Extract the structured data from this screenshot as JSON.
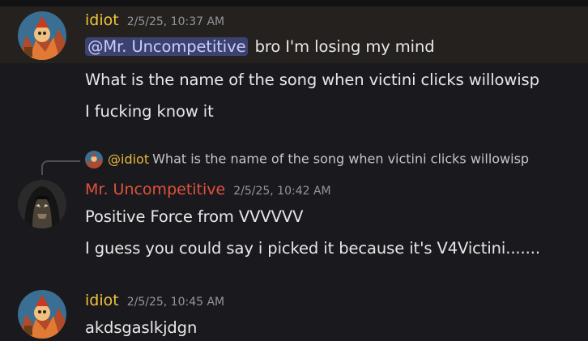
{
  "messages": [
    {
      "author": "idiot",
      "author_color": "#f0c23c",
      "timestamp": "2/5/25, 10:37 AM",
      "mention": "@Mr. Uncompetitive",
      "line1_rest": "bro I'm losing my mind",
      "line2": "What is the name of the song when victini clicks willowisp",
      "line3": "I fucking know it"
    },
    {
      "reply_author": "@idiot",
      "reply_text": "What is the name of the song when victini clicks willowisp",
      "author": "Mr. Uncompetitive",
      "author_color": "#e0513d",
      "timestamp": "2/5/25, 10:42 AM",
      "line1": "Positive Force from VVVVVV",
      "line2": "I guess you could say i picked it because it's V4Victini......."
    },
    {
      "author": "idiot",
      "author_color": "#f0c23c",
      "timestamp": "2/5/25, 10:45 AM",
      "line1": "akdsgaslkjdgn"
    }
  ]
}
